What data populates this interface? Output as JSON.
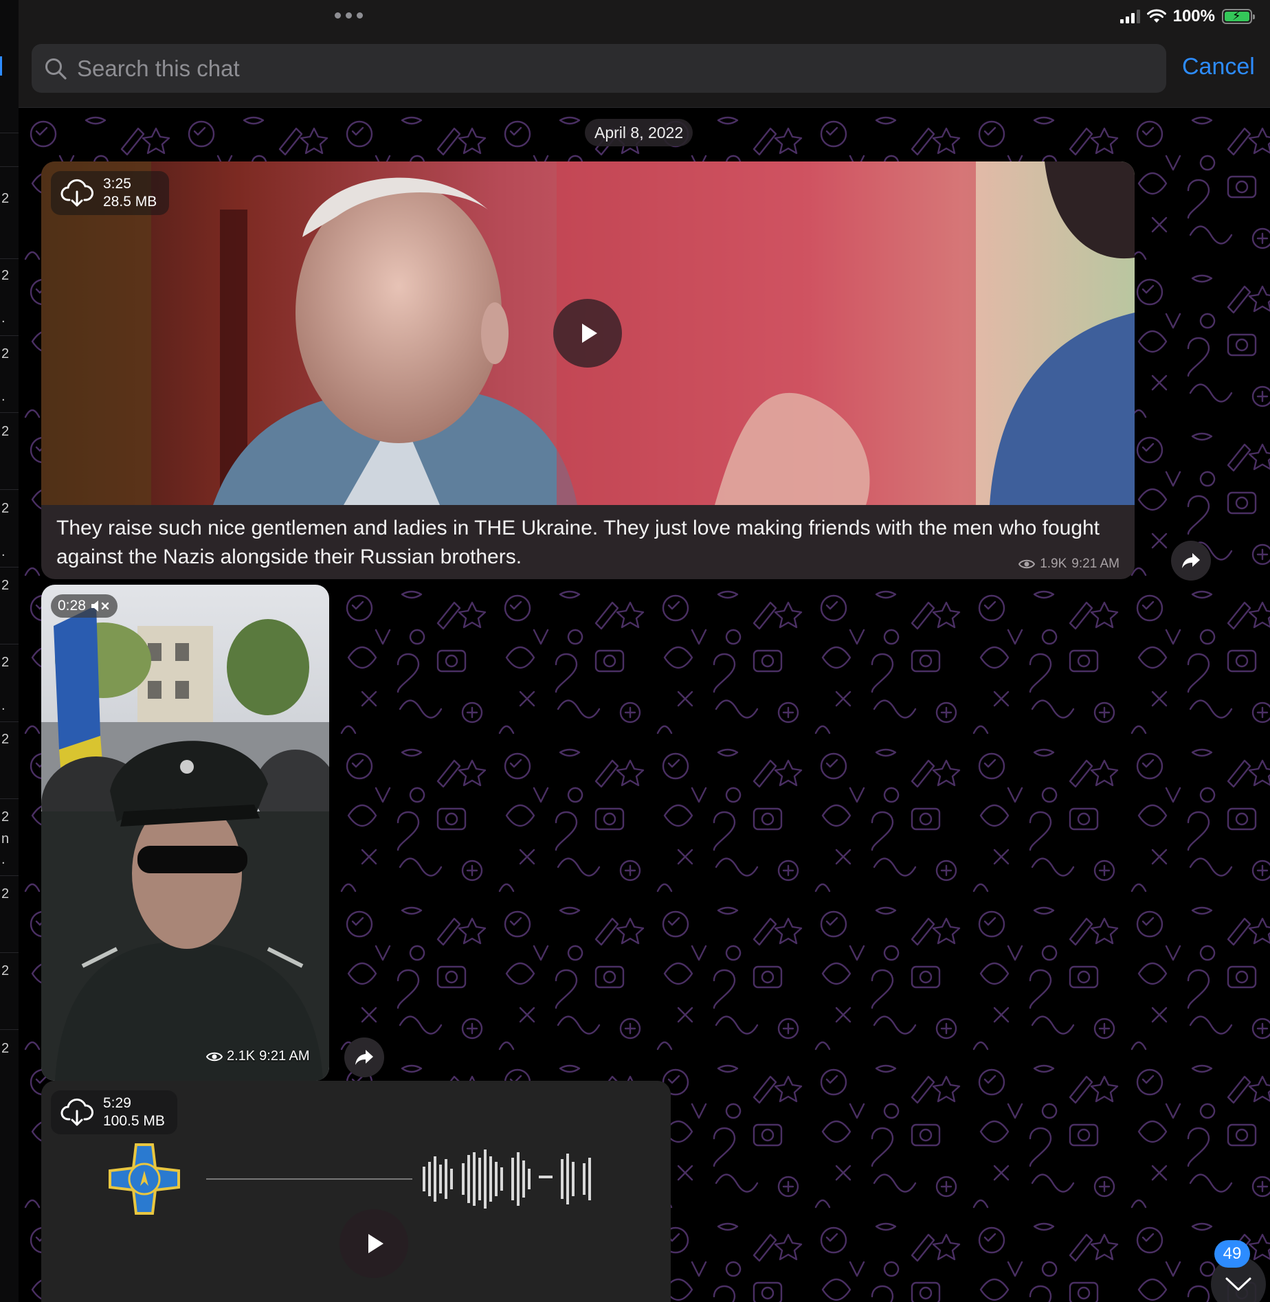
{
  "status_bar": {
    "battery": "100%"
  },
  "search": {
    "placeholder": "Search this chat",
    "cancel_label": "Cancel"
  },
  "left_panel": {
    "marks": [
      "2",
      "2",
      ".",
      "2",
      ".",
      "2",
      "2",
      ".",
      "2",
      "2",
      ".",
      "2",
      "2",
      "n",
      ".",
      "2",
      "2",
      "2"
    ]
  },
  "chat": {
    "date": "April 8, 2022",
    "messages": [
      {
        "kind": "video",
        "duration": "3:25",
        "size": "28.5 MB",
        "caption": "They raise such nice gentlemen and ladies in THE Ukraine.  They just love making friends with the men who fought against the Nazis alongside their Russian brothers.",
        "views": "1.9K",
        "time": "9:21 AM"
      },
      {
        "kind": "video",
        "duration": "0:28",
        "views": "2.1K",
        "time": "9:21 AM"
      },
      {
        "kind": "video",
        "duration": "5:29",
        "size": "100.5 MB"
      }
    ]
  },
  "unread_count": "49",
  "colors": {
    "accent": "#2d8cff",
    "bubble": "#2b2528",
    "pattern": "#4a2f63"
  },
  "icons": [
    "search-icon",
    "cloud-download-icon",
    "play-icon",
    "eye-icon",
    "share-icon",
    "mute-icon",
    "chevron-down-icon",
    "wifi-icon",
    "battery-icon"
  ]
}
